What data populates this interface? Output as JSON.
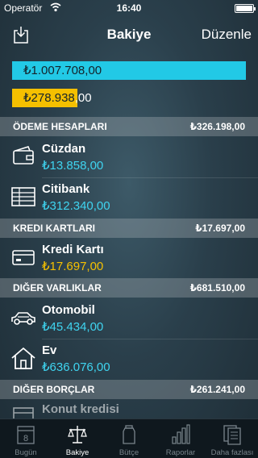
{
  "status": {
    "carrier": "Operatör",
    "time": "16:40"
  },
  "nav": {
    "title": "Bakiye",
    "edit": "Düzenle"
  },
  "summary": {
    "total": "₺1.007.708,00",
    "debt_highlight": "₺278.938",
    "debt_rest": ",00"
  },
  "sections": [
    {
      "name": "ÖDEME HESAPLARI",
      "total": "₺326.198,00"
    },
    {
      "name": "KREDI KARTLARI",
      "total": "₺17.697,00"
    },
    {
      "name": "DIĞER VARLIKLAR",
      "total": "₺681.510,00"
    },
    {
      "name": "DIĞER BORÇLAR",
      "total": "₺261.241,00"
    }
  ],
  "accounts": [
    {
      "name": "Cüzdan",
      "value": "₺13.858,00",
      "icon": "wallet-icon"
    },
    {
      "name": "Citibank",
      "value": "₺312.340,00",
      "icon": "bank-ledger-icon"
    },
    {
      "name": "Kredi Kartı",
      "value": "₺17.697,00",
      "icon": "credit-card-icon"
    },
    {
      "name": "Otomobil",
      "value": "₺45.434,00",
      "icon": "car-icon"
    },
    {
      "name": "Ev",
      "value": "₺636.076,00",
      "icon": "house-icon"
    },
    {
      "name": "Konut kredisi",
      "value": "",
      "icon": "mortgage-icon"
    }
  ],
  "tabs": [
    {
      "label": "Bugün",
      "icon": "calendar-icon",
      "day": "8"
    },
    {
      "label": "Bakiye",
      "icon": "scales-icon"
    },
    {
      "label": "Bütçe",
      "icon": "jar-icon"
    },
    {
      "label": "Raporlar",
      "icon": "bar-chart-icon"
    },
    {
      "label": "Daha fazlası",
      "icon": "documents-icon"
    }
  ],
  "colors": {
    "cyan": "#22c9e6",
    "yellow": "#f5c000",
    "tab_active": "#ffffff",
    "tab_inactive": "#7a858c"
  }
}
